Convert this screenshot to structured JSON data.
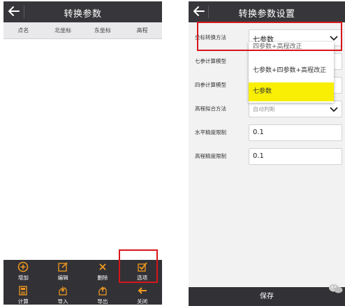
{
  "left_screen": {
    "title": "转换参数",
    "columns": [
      "点名",
      "北坐标",
      "东坐标",
      "高程"
    ],
    "toolbar": {
      "row1": [
        {
          "label": "增加",
          "icon": "plus-circle-icon"
        },
        {
          "label": "编辑",
          "icon": "edit-icon"
        },
        {
          "label": "删除",
          "icon": "delete-x-icon"
        },
        {
          "label": "选项",
          "icon": "checkbox-icon"
        }
      ],
      "row2": [
        {
          "label": "计算",
          "icon": "calculator-icon"
        },
        {
          "label": "导入",
          "icon": "import-hand-icon"
        },
        {
          "label": "导出",
          "icon": "export-hand-icon"
        },
        {
          "label": "关闭",
          "icon": "arrow-back-icon"
        }
      ]
    }
  },
  "right_screen": {
    "title": "转换参数设置",
    "rows": [
      {
        "label": "坐标转换方法",
        "value": "七参数"
      },
      {
        "label": "七参计算模型",
        "value": ""
      },
      {
        "label": "四参计算模型",
        "value": ""
      },
      {
        "label": "高程拟合方法",
        "value": "自动判断"
      },
      {
        "label": "水平精度限制",
        "value": "0.1"
      },
      {
        "label": "高程精度限制",
        "value": "0.1"
      }
    ],
    "dropdown_options": [
      "四参数+高程改正",
      "七参数+四参数+高程改正",
      "七参数"
    ],
    "selected_option": "七参数",
    "save_label": "保存"
  },
  "colors": {
    "header_bg": "#37373b",
    "highlight_border": "#d9141b",
    "selected_option_bg": "#f8ef05"
  }
}
